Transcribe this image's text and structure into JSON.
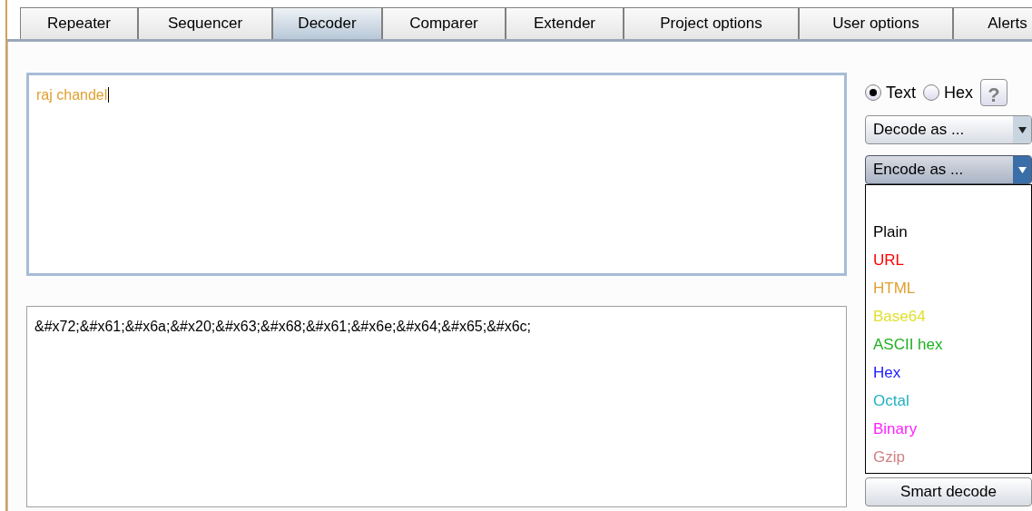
{
  "tabs": [
    {
      "label": "Repeater",
      "selected": false
    },
    {
      "label": "Sequencer",
      "selected": false
    },
    {
      "label": "Decoder",
      "selected": true
    },
    {
      "label": "Comparer",
      "selected": false
    },
    {
      "label": "Extender",
      "selected": false
    },
    {
      "label": "Project options",
      "selected": false
    },
    {
      "label": "User options",
      "selected": false
    },
    {
      "label": "Alerts",
      "selected": false
    }
  ],
  "input_pane": {
    "value": "raj chandel"
  },
  "output_pane": {
    "value": "&#x72;&#x61;&#x6a;&#x20;&#x63;&#x68;&#x61;&#x6e;&#x64;&#x65;&#x6c;"
  },
  "mode": [
    {
      "label": "Text",
      "selected": true
    },
    {
      "label": "Hex",
      "selected": false
    }
  ],
  "help_button": {
    "label": "?"
  },
  "decode_dropdown": {
    "label": "Decode as ...",
    "expanded": false
  },
  "encode_dropdown": {
    "label": "Encode as ...",
    "expanded": true,
    "options": [
      {
        "label": "Plain",
        "color": "#000000"
      },
      {
        "label": "URL",
        "color": "#ff0000"
      },
      {
        "label": "HTML",
        "color": "#e0a030"
      },
      {
        "label": "Base64",
        "color": "#e0e030"
      },
      {
        "label": "ASCII hex",
        "color": "#20b020"
      },
      {
        "label": "Hex",
        "color": "#2020ff"
      },
      {
        "label": "Octal",
        "color": "#20b0c0"
      },
      {
        "label": "Binary",
        "color": "#ff20ff"
      },
      {
        "label": "Gzip",
        "color": "#d08080"
      }
    ]
  },
  "smart_decode_button": {
    "label": "Smart decode"
  }
}
